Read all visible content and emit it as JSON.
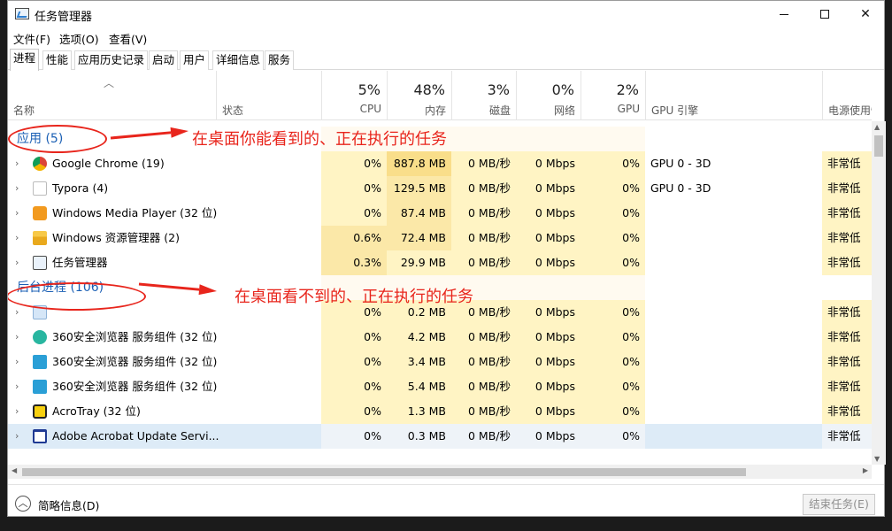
{
  "window": {
    "title": "任务管理器",
    "minimize": "—",
    "maximize": "☐",
    "close": "✕"
  },
  "menu": [
    "文件(F)",
    "选项(O)",
    "查看(V)"
  ],
  "tabs": [
    "进程",
    "性能",
    "应用历史记录",
    "启动",
    "用户",
    "详细信息",
    "服务"
  ],
  "columns": {
    "name": "名称",
    "status": "状态",
    "cpu_pct": "5%",
    "cpu": "CPU",
    "mem_pct": "48%",
    "mem": "内存",
    "disk_pct": "3%",
    "disk": "磁盘",
    "net_pct": "0%",
    "net": "网络",
    "gpu_pct": "2%",
    "gpu": "GPU",
    "gpu_engine": "GPU 引擎",
    "power": "电源使用情"
  },
  "groups": {
    "apps": "应用 (5)",
    "background": "后台进程 (106)"
  },
  "annotations": {
    "apps_note": "在桌面你能看到的、正在执行的任务",
    "bg_note": "在桌面看不到的、正在执行的任务",
    "color": "#e8251c"
  },
  "apps": [
    {
      "name": "Google Chrome (19)",
      "icon": "chrome-icon",
      "cpu": "0%",
      "mem": "887.8 MB",
      "disk": "0 MB/秒",
      "net": "0 Mbps",
      "gpu": "0%",
      "engine": "GPU 0 - 3D",
      "power": "非常低"
    },
    {
      "name": "Typora (4)",
      "icon": "typora-icon",
      "cpu": "0%",
      "mem": "129.5 MB",
      "disk": "0 MB/秒",
      "net": "0 Mbps",
      "gpu": "0%",
      "engine": "GPU 0 - 3D",
      "power": "非常低"
    },
    {
      "name": "Windows Media Player (32 位)",
      "icon": "media-player-icon",
      "cpu": "0%",
      "mem": "87.4 MB",
      "disk": "0 MB/秒",
      "net": "0 Mbps",
      "gpu": "0%",
      "engine": "",
      "power": "非常低"
    },
    {
      "name": "Windows 资源管理器 (2)",
      "icon": "folder-icon",
      "cpu": "0.6%",
      "mem": "72.4 MB",
      "disk": "0 MB/秒",
      "net": "0 Mbps",
      "gpu": "0%",
      "engine": "",
      "power": "非常低"
    },
    {
      "name": "任务管理器",
      "icon": "task-manager-icon",
      "cpu": "0.3%",
      "mem": "29.9 MB",
      "disk": "0 MB/秒",
      "net": "0 Mbps",
      "gpu": "0%",
      "engine": "",
      "power": "非常低"
    }
  ],
  "background": [
    {
      "name": "",
      "icon": "gear-icon",
      "cpu": "0%",
      "mem": "0.2 MB",
      "disk": "0 MB/秒",
      "net": "0 Mbps",
      "gpu": "0%",
      "engine": "",
      "power": "非常低"
    },
    {
      "name": "360安全浏览器 服务组件 (32 位)",
      "icon": "browser-360-icon",
      "cpu": "0%",
      "mem": "4.2 MB",
      "disk": "0 MB/秒",
      "net": "0 Mbps",
      "gpu": "0%",
      "engine": "",
      "power": "非常低"
    },
    {
      "name": "360安全浏览器 服务组件 (32 位)",
      "icon": "browser-360-alt-icon",
      "cpu": "0%",
      "mem": "3.4 MB",
      "disk": "0 MB/秒",
      "net": "0 Mbps",
      "gpu": "0%",
      "engine": "",
      "power": "非常低"
    },
    {
      "name": "360安全浏览器 服务组件 (32 位)",
      "icon": "browser-360-alt-icon",
      "cpu": "0%",
      "mem": "5.4 MB",
      "disk": "0 MB/秒",
      "net": "0 Mbps",
      "gpu": "0%",
      "engine": "",
      "power": "非常低"
    },
    {
      "name": "AcroTray (32 位)",
      "icon": "acrotray-icon",
      "cpu": "0%",
      "mem": "1.3 MB",
      "disk": "0 MB/秒",
      "net": "0 Mbps",
      "gpu": "0%",
      "engine": "",
      "power": "非常低"
    },
    {
      "name": "Adobe Acrobat Update Servi...",
      "icon": "window-icon",
      "cpu": "0%",
      "mem": "0.3 MB",
      "disk": "0 MB/秒",
      "net": "0 Mbps",
      "gpu": "0%",
      "engine": "",
      "power": "非常低"
    }
  ],
  "footer": {
    "fewer_details": "简略信息(D)",
    "end_task": "结束任务(E)"
  },
  "colors": {
    "heat_light": "#fff4c4",
    "heat_mid": "#fbe8a8",
    "heat_strong": "#f9de8a",
    "selected": "#ddebf7",
    "group_blue": "#1a5fb4"
  }
}
